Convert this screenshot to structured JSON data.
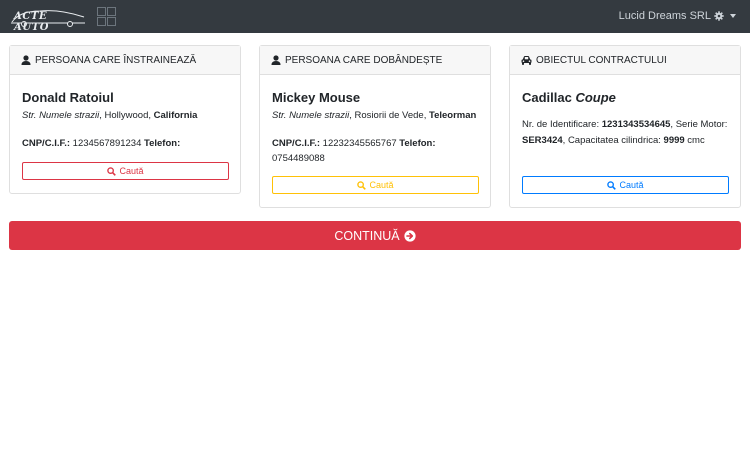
{
  "navbar": {
    "logo_text": "ACTE AUTO",
    "user_name": "Lucid Dreams SRL",
    "icons": {
      "grid": "apps-grid-icon",
      "settings": "gear-icon",
      "dropdown": "caret-down-icon"
    }
  },
  "cards": [
    {
      "header": "PERSOANA CARE ÎNSTRAINEAZĂ",
      "icon": "user-icon",
      "name": "Donald Ratoiul",
      "street": "Str. Numele strazii",
      "city": ", Hollywood, ",
      "region": "California",
      "cnp_label": "CNP/C.I.F.:",
      "cnp_value": " 1234567891234 ",
      "phone_label": "Telefon:",
      "phone_value": "",
      "button_label": "Caută",
      "button_color": "#dc3545"
    },
    {
      "header": "PERSOANA CARE DOBÂNDEȘTE",
      "icon": "user-icon",
      "name": "Mickey Mouse",
      "street": "Str. Numele strazii",
      "city": ", Rosiorii de Vede, ",
      "region": "Teleorman",
      "cnp_label": "CNP/C.I.F.:",
      "cnp_value": " 12232345565767 ",
      "phone_label": "Telefon:",
      "phone_value": "0754489088",
      "button_label": "Caută",
      "button_color": "#ffc107"
    },
    {
      "header": "OBIECTUL CONTRACTULUI",
      "icon": "car-icon",
      "make": "Cadillac ",
      "model": "Coupe",
      "vin_label": "Nr. de Identificare: ",
      "vin_value": "1231343534645",
      "engine_label": ", Serie Motor: ",
      "engine_value": "SER3424",
      "capacity_label": ", Capacitatea cilindrica: ",
      "capacity_value": "9999",
      "capacity_unit": " cmc",
      "button_label": "Caută",
      "button_color": "#007bff"
    }
  ],
  "continue": {
    "label": "CONTINUĂ",
    "icon": "arrow-circle-right-icon",
    "color": "#dc3545"
  }
}
